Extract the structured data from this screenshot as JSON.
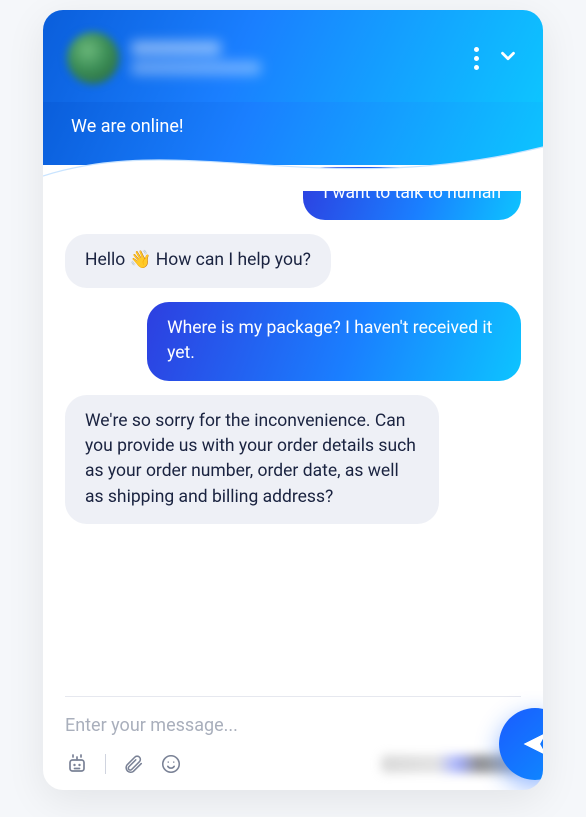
{
  "header": {
    "status_text": "We are online!"
  },
  "messages": [
    {
      "role": "user",
      "text": "I want to talk to human"
    },
    {
      "role": "agent",
      "text": "Hello 👋 How can I help you?"
    },
    {
      "role": "user",
      "text": "Where is my package? I haven't received it yet."
    },
    {
      "role": "agent",
      "text": "We're so sorry for the inconvenience. Can you provide us with your order details such as your order number, order date, as well as shipping and billing address?"
    }
  ],
  "composer": {
    "placeholder": "Enter your message..."
  },
  "icons": {
    "bot": "bot-icon",
    "attach": "paperclip-icon",
    "emoji": "smiley-icon",
    "send": "send-icon"
  }
}
